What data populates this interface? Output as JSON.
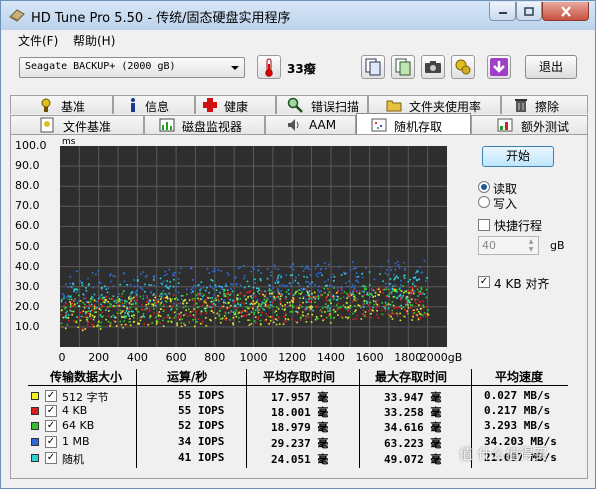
{
  "window": {
    "title": "HD Tune Pro 5.50 - 传统/固态硬盘实用程序"
  },
  "menu": {
    "file": "文件(F)",
    "help": "帮助(H)"
  },
  "toolbar": {
    "drive": "Seagate BACKUP+ (2000 gB)",
    "temperature": "33癈",
    "exit_label": "退出"
  },
  "tabs_top": [
    {
      "label": "基准",
      "icon": "benchmark-icon"
    },
    {
      "label": "信息",
      "icon": "info-icon"
    },
    {
      "label": "健康",
      "icon": "health-cross-icon"
    },
    {
      "label": "错误扫描",
      "icon": "magnifier-icon"
    },
    {
      "label": "文件夹使用率",
      "icon": "folder-icon"
    },
    {
      "label": "擦除",
      "icon": "trash-icon"
    }
  ],
  "tabs_bottom": [
    {
      "label": "文件基准",
      "icon": "file-benchmark-icon"
    },
    {
      "label": "磁盘监视器",
      "icon": "disk-monitor-icon"
    },
    {
      "label": "AAM",
      "icon": "speaker-icon"
    },
    {
      "label": "随机存取",
      "icon": "random-access-icon",
      "active": true
    },
    {
      "label": "额外测试",
      "icon": "extra-tests-icon"
    }
  ],
  "chart_data": {
    "type": "scatter",
    "title": "",
    "ylabel": "ms",
    "xlabel": "",
    "y_ticks": [
      "100.0",
      "90.0",
      "80.0",
      "70.0",
      "60.0",
      "50.0",
      "40.0",
      "30.0",
      "20.0",
      "10.0"
    ],
    "x_ticks": [
      "0",
      "200",
      "400",
      "600",
      "800",
      "1000",
      "1200",
      "1400",
      "1600",
      "1800",
      "2000gB"
    ],
    "xlim": [
      0,
      2000
    ],
    "ylim": [
      0,
      100
    ],
    "grid": true,
    "series": [
      {
        "name": "512 字节",
        "color": "#e8e830",
        "band": [
          8,
          24
        ]
      },
      {
        "name": "4 KB",
        "color": "#e02020",
        "band": [
          9,
          25
        ]
      },
      {
        "name": "64 KB",
        "color": "#30d030",
        "band": [
          10,
          26
        ]
      },
      {
        "name": "1 MB",
        "color": "#3070e0",
        "band": [
          20,
          38
        ]
      },
      {
        "name": "随机",
        "color": "#30d8d8",
        "band": [
          14,
          33
        ]
      }
    ]
  },
  "controls": {
    "start_label": "开始",
    "read_label": "读取",
    "write_label": "写入",
    "quick_label": "快捷行程",
    "quick_value": "40",
    "quick_unit": "gB",
    "align_label": "4 KB 对齐"
  },
  "results": {
    "headers": [
      "传输数据大小",
      "运算/秒",
      "平均存取时间",
      "最大存取时间",
      "平均速度"
    ],
    "rows": [
      {
        "name": "512 字节",
        "color": "#f0f020",
        "ops": "55 IOPS",
        "avg": "17.957 毫",
        "max": "33.947 毫",
        "speed": "0.027 MB/s"
      },
      {
        "name": "4 KB",
        "color": "#d82020",
        "ops": "55 IOPS",
        "avg": "18.001 毫",
        "max": "33.258 毫",
        "speed": "0.217 MB/s"
      },
      {
        "name": "64 KB",
        "color": "#30c030",
        "ops": "52 IOPS",
        "avg": "18.979 毫",
        "max": "34.616 毫",
        "speed": "3.293 MB/s"
      },
      {
        "name": "1 MB",
        "color": "#2f68d8",
        "ops": "34 IOPS",
        "avg": "29.237 毫",
        "max": "63.223 毫",
        "speed": "34.203 MB/s"
      },
      {
        "name": "随机",
        "color": "#30d0d0",
        "ops": "41 IOPS",
        "avg": "24.051 毫",
        "max": "49.072 毫",
        "speed": "21.097 MB/s"
      }
    ]
  },
  "watermark": "值 什么值得买"
}
